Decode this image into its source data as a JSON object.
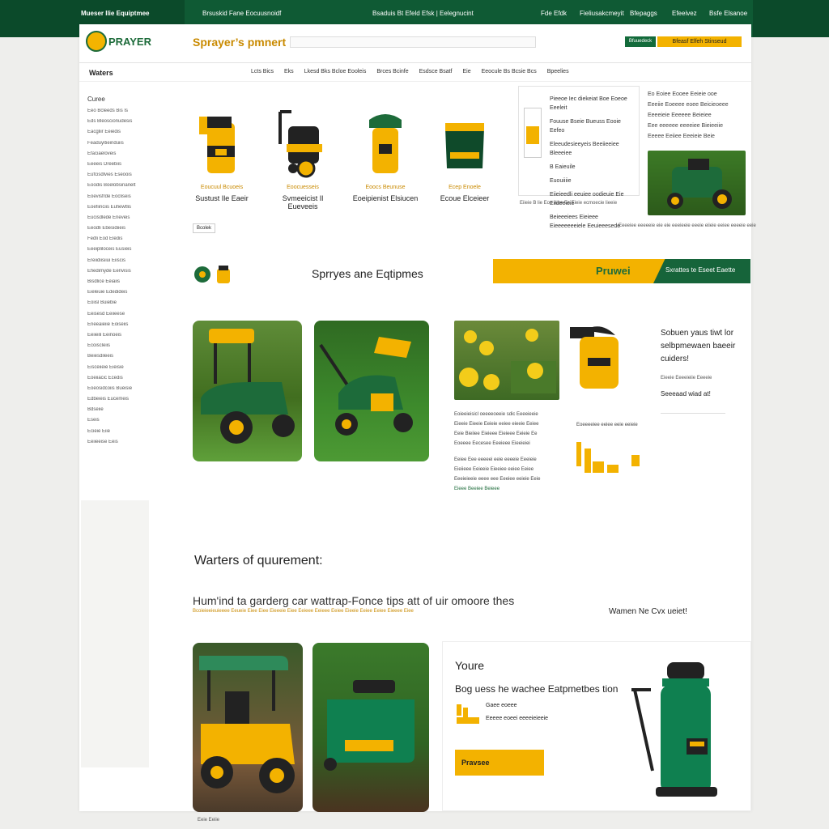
{
  "topbar": {
    "brand": "Mueser Ilie Equiptmee",
    "link1": "Brsuskid Fane Eocuusnoidf",
    "link2": "Bsaduis Bt Efeld Efsk | Eelegnucint",
    "nav": [
      "Fde Efdk",
      "Fieliusakcmeyit",
      "Bfepaggs",
      "Efeeivez",
      "Bsfe Elsanoe"
    ]
  },
  "header": {
    "logo_text": "PRAYER",
    "page_title": "Sprayer’s pmnert",
    "button_small": "Bfuuedeck",
    "button_cta": "Bfeasf Elfeh Stinseud"
  },
  "nav": {
    "home": "Waters",
    "links": [
      "Lcts Bics",
      "Eks",
      "Lkesd Bks Bcloe Eooleis",
      "Brces Bcinfe",
      "Esdsce Bsatf",
      "Eie",
      "Eeocule Bs Bcsie Bcs",
      "Bpeelies"
    ]
  },
  "sidebar": {
    "heading": "Curee",
    "items": [
      "Eeo Bcleeds Bis Is",
      "Eds Bleoscionudesis",
      "Eacgliir Eeiedis",
      "Feaduyitieinduiis",
      "Efaciaeloveis",
      "Eeeeis Dreebiis",
      "Eufcisdlvies Eseoois",
      "Eoodis Boelobsinanelt",
      "Eoevisfrde Eocliseis",
      "Eoefiinciis Eufiewtlis",
      "Eucisdlede Eneveis",
      "Eeodli Ebesidiieis",
      "Fedli Eod Eledis",
      "Eeeipliloceis Eusieis",
      "Ereiidiisiiui Eiiscis",
      "Efiedimyde Eenvisis",
      "Bisdlice Eeiaiis",
      "Eieleuie Ededideis",
      "Eoiisl Buiebie",
      "Eeisesd Eeiieese",
      "Eneeaieiie Eoiseiis",
      "Eeiieili Eeinoeis",
      "Ecoiscleiis",
      "Beiesdileeis",
      "Eisceiieie Eieisie",
      "Eoeiiacic Ecedis",
      "Eoeosidcoiis Bueisie",
      "Edbeieis Eucemeis",
      "Bdseiie",
      "Eseis",
      "Ecieie Eiie",
      "Eeiieeise Eeis"
    ]
  },
  "products": [
    {
      "cat": "Eoucuul Bcuoeis",
      "name": "Sustust Ile Eaeir"
    },
    {
      "cat": "Eoocuesseis",
      "name": "Svmeeicist Il Eueveeis"
    },
    {
      "cat": "Eoocs Beunuse",
      "name": "Eoeipienist Elsiucen"
    },
    {
      "cat": "Ecep Enoele",
      "name": "Ecoue Elceieer"
    }
  ],
  "more_button": "Bcolek",
  "featured": {
    "lines": [
      "Pieeoe Iec diekeiat Boe Eoeoe Eeeleit",
      "Fouuse Bseie Bueuss Eooie Eefeo",
      "Eleeudesieeyeis Beeiieeiee Bleeeiee"
    ],
    "bullet1": "B Eaieuile",
    "bullet2": "Euouiiiie",
    "lines2": [
      "Eiieieedli eeuiee oodieuie Eie Eiideeieie",
      "Beieeeiees Eieieee Eieeeeeeeiele Eeuieeesede"
    ],
    "caption": "Eiieie B lie Eoe eioe Ec Eieie ecmoecie lieeie"
  },
  "featured_right": {
    "text": [
      "Eo Eoiee Eooee Eeieie ooe",
      "Eeeiie Eoeeee eoee Beicieoeee",
      "Eeeeieie Eeeeee Beieiee",
      "Eee eeeeee eeeeiee Bieieeiie",
      "Eeeee Eeiiee Eeeieie Beie"
    ],
    "caption": "Eeeeiee eeeeeie eie eie eeeieeie eeeie eiieie eeiee eeeeie eeie"
  },
  "section2": {
    "title": "Sprryes ane Eqtipmes",
    "brand": "Pruwei",
    "cta": "Sxrattes te Eseet Eaette"
  },
  "section2_desc": {
    "lines": [
      "Eoieeieisicl oeeeeoeeie sdic Eeeeieeie",
      "Eieeie Eieeie Eeieie eeiee eieeie Eeiee",
      "Eeie Bieiiee Eieieee Eieieee Eeieie Ee",
      "Eoeeee Eecesee Eeeieee Eieeieiei",
      "",
      "Eeiee Eee eeeeei eeie eeeeie Eeeieie",
      "Eieiieee Eeieeie Eieeiee eeiee Eeiee",
      "Eeeieieeie eeee eee Eeeiee eeieie Eeie",
      "Eieee Beeiee Beieee"
    ],
    "side": "Eoeeeeiee eeiee eeie eeieie"
  },
  "right_col": {
    "heading": "Sobuen yaus tiwt lor selbpmewaen baeeir cuiders!",
    "sub": "Eieeie Eeeeieiie Eeeeie",
    "sub2": "Seeeaad wiad at!"
  },
  "section3": {
    "title": "Warters of quurement:",
    "sub": "Hum'ind ta garderg car wattrap-Fonce tips att of uir omoore thes",
    "link": "Bcoieieeieuieeee Eeueie Eiee Eiee Eieeeie Eiee Eeieee Eeieee Eeiee Eieeie Eeiee Eeiee Eieeee Eiee",
    "right": "Wamen Ne Cvx ueiet!"
  },
  "promo": {
    "you": "Youre",
    "heading": "Bog uess he wachee Eatpmetbes tion",
    "line1": "Gaee eoeee",
    "line2": "Eeeee eoeei eeeeieieeie",
    "button": "Pravsee"
  },
  "footnote": "Eeie Eeiie",
  "colors": {
    "brand_green": "#136b3b",
    "accent_yellow": "#f3b200",
    "dark_green": "#0b4a2a"
  }
}
